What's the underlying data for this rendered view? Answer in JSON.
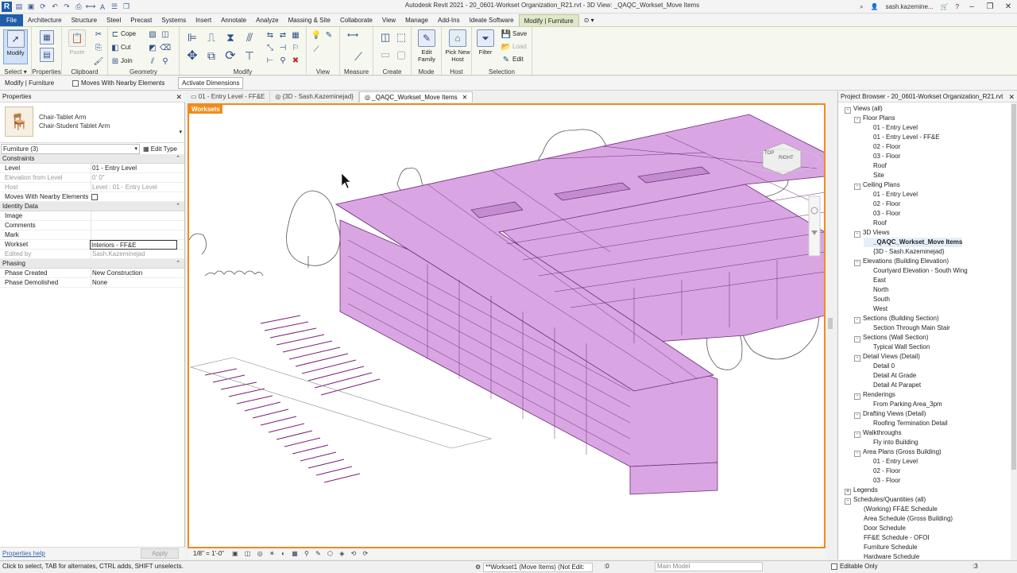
{
  "titlebar": {
    "title": "Autodesk Revit 2021 - 20_0601-Workset Organization_R21.rvt - 3D View: _QAQC_Workset_Move Items",
    "user": "sash.kazemine...",
    "logo": "R",
    "qat_icons": [
      "open-icon",
      "save-icon",
      "sync-icon",
      "undo-icon",
      "redo-icon",
      "print-icon",
      "measure-icon",
      "text-icon"
    ]
  },
  "ribbon_tabs": [
    "File",
    "Architecture",
    "Structure",
    "Steel",
    "Precast",
    "Systems",
    "Insert",
    "Annotate",
    "Analyze",
    "Massing & Site",
    "Collaborate",
    "View",
    "Manage",
    "Add-Ins",
    "Ideate Software",
    "Modify | Furniture"
  ],
  "ribbon": {
    "select": {
      "modify_label": "Modify",
      "panel_label": "Select"
    },
    "properties": {
      "panel_label": "Properties"
    },
    "clipboard": {
      "paste_label": "Paste",
      "cope_label": "Cope",
      "cut_label": "Cut",
      "join_label": "Join",
      "panel_label": "Clipboard"
    },
    "geometry": {
      "panel_label": "Geometry"
    },
    "modify": {
      "panel_label": "Modify"
    },
    "view": {
      "panel_label": "View"
    },
    "measure": {
      "panel_label": "Measure"
    },
    "create": {
      "panel_label": "Create"
    },
    "mode": {
      "edit_family_label": "Edit Family",
      "panel_label": "Mode"
    },
    "host": {
      "pick_new_host_label": "Pick New Host",
      "panel_label": "Host"
    },
    "selection": {
      "filter_label": "Filter",
      "save_label": "Save",
      "load_label": "Load",
      "edit_label": "Edit",
      "panel_label": "Selection"
    }
  },
  "optionsbar": {
    "context": "Modify | Furniture",
    "moves_with_nearby": "Moves With Nearby Elements",
    "activate_dimensions": "Activate Dimensions"
  },
  "properties": {
    "title": "Properties",
    "type_family": "Chair-Tablet Arm",
    "type_name": "Chair-Student Tablet Arm",
    "instance_selector": "Furniture (3)",
    "edit_type": "Edit Type",
    "groups": [
      {
        "name": "Constraints"
      },
      {
        "name": "Identity Data"
      },
      {
        "name": "Phasing"
      }
    ],
    "rows": {
      "level_k": "Level",
      "level_v": "01 - Entry Level",
      "elev_k": "Elevation from Level",
      "elev_v": "0' 0\"",
      "host_k": "Host",
      "host_v": "Level : 01 - Entry Level",
      "moves_k": "Moves With Nearby Elements",
      "image_k": "Image",
      "comments_k": "Comments",
      "mark_k": "Mark",
      "workset_k": "Workset",
      "workset_v": "Interiors - FF&E",
      "editedby_k": "Edited by",
      "editedby_v": "Sash.Kazeminejad",
      "phasecreated_k": "Phase Created",
      "phasecreated_v": "New Construction",
      "phasedemo_k": "Phase Demolished",
      "phasedemo_v": "None"
    },
    "help": "Properties help",
    "apply": "Apply"
  },
  "view_tabs": [
    {
      "label": "01 - Entry Level - FF&E",
      "active": false
    },
    {
      "label": "{3D - Sash.Kazeminejad}",
      "active": false
    },
    {
      "label": "_QAQC_Workset_Move Items",
      "active": true
    }
  ],
  "viewport": {
    "workset_label": "Worksets",
    "viewcube_top": "TOP",
    "viewcube_right": "RIGHT",
    "highlight_color": "#d9a6e3"
  },
  "viewctrl": {
    "scale": "1/8\" = 1'-0\""
  },
  "browser": {
    "title": "Project Browser - 20_0601-Workset Organization_R21.rvt",
    "nodes": [
      {
        "t": "Views (all)",
        "lvl": 0,
        "tg": "-"
      },
      {
        "t": "Floor Plans",
        "lvl": 1,
        "tg": "-"
      },
      {
        "t": "01 - Entry Level",
        "lvl": 2
      },
      {
        "t": "01 - Entry Level - FF&E",
        "lvl": 2
      },
      {
        "t": "02 - Floor",
        "lvl": 2
      },
      {
        "t": "03 - Floor",
        "lvl": 2
      },
      {
        "t": "Roof",
        "lvl": 2
      },
      {
        "t": "Site",
        "lvl": 2
      },
      {
        "t": "Ceiling Plans",
        "lvl": 1,
        "tg": "-"
      },
      {
        "t": "01 - Entry Level",
        "lvl": 2
      },
      {
        "t": "02 - Floor",
        "lvl": 2
      },
      {
        "t": "03 - Floor",
        "lvl": 2
      },
      {
        "t": "Roof",
        "lvl": 2
      },
      {
        "t": "3D Views",
        "lvl": 1,
        "tg": "-"
      },
      {
        "t": "_QAQC_Workset_Move Items",
        "lvl": 2,
        "sel": true
      },
      {
        "t": "{3D - Sash.Kazeminejad}",
        "lvl": 2
      },
      {
        "t": "Elevations (Building Elevation)",
        "lvl": 1,
        "tg": "-"
      },
      {
        "t": "Courtyard Elevation - South Wing",
        "lvl": 2
      },
      {
        "t": "East",
        "lvl": 2
      },
      {
        "t": "North",
        "lvl": 2
      },
      {
        "t": "South",
        "lvl": 2
      },
      {
        "t": "West",
        "lvl": 2
      },
      {
        "t": "Sections (Building Section)",
        "lvl": 1,
        "tg": "-"
      },
      {
        "t": "Section Through Main Stair",
        "lvl": 2
      },
      {
        "t": "Sections (Wall Section)",
        "lvl": 1,
        "tg": "-"
      },
      {
        "t": "Typical Wall Section",
        "lvl": 2
      },
      {
        "t": "Detail Views (Detail)",
        "lvl": 1,
        "tg": "-"
      },
      {
        "t": "Detail 0",
        "lvl": 2
      },
      {
        "t": "Detail At Grade",
        "lvl": 2
      },
      {
        "t": "Detail At Parapet",
        "lvl": 2
      },
      {
        "t": "Renderings",
        "lvl": 1,
        "tg": "-"
      },
      {
        "t": "From Parking Area_3pm",
        "lvl": 2
      },
      {
        "t": "Drafting Views (Detail)",
        "lvl": 1,
        "tg": "-"
      },
      {
        "t": "Roofing Termination Detail",
        "lvl": 2
      },
      {
        "t": "Walkthroughs",
        "lvl": 1,
        "tg": "-"
      },
      {
        "t": "Fly into Building",
        "lvl": 2
      },
      {
        "t": "Area Plans (Gross Building)",
        "lvl": 1,
        "tg": "-"
      },
      {
        "t": "01 - Entry Level",
        "lvl": 2
      },
      {
        "t": "02 - Floor",
        "lvl": 2
      },
      {
        "t": "03 - Floor",
        "lvl": 2
      },
      {
        "t": "Legends",
        "lvl": 0,
        "tg": "+"
      },
      {
        "t": "Schedules/Quantities (all)",
        "lvl": 0,
        "tg": "-"
      },
      {
        "t": "(Working) FF&E Schedule",
        "lvl": 1
      },
      {
        "t": "Area Schedule (Gross Building)",
        "lvl": 1
      },
      {
        "t": "Door Schedule",
        "lvl": 1
      },
      {
        "t": "FF&E Schedule - OFOI",
        "lvl": 1
      },
      {
        "t": "Furniture Schedule",
        "lvl": 1
      },
      {
        "t": "Hardware Schedule",
        "lvl": 1
      }
    ]
  },
  "status": {
    "message": "Click to select, TAB for alternates, CTRL adds, SHIFT unselects.",
    "workset": "**Workset1 (Move Items) (Not Edit:",
    "zero": ":0",
    "model": "Main Model",
    "editable_only": "Editable Only",
    "filter_count": ":3"
  }
}
